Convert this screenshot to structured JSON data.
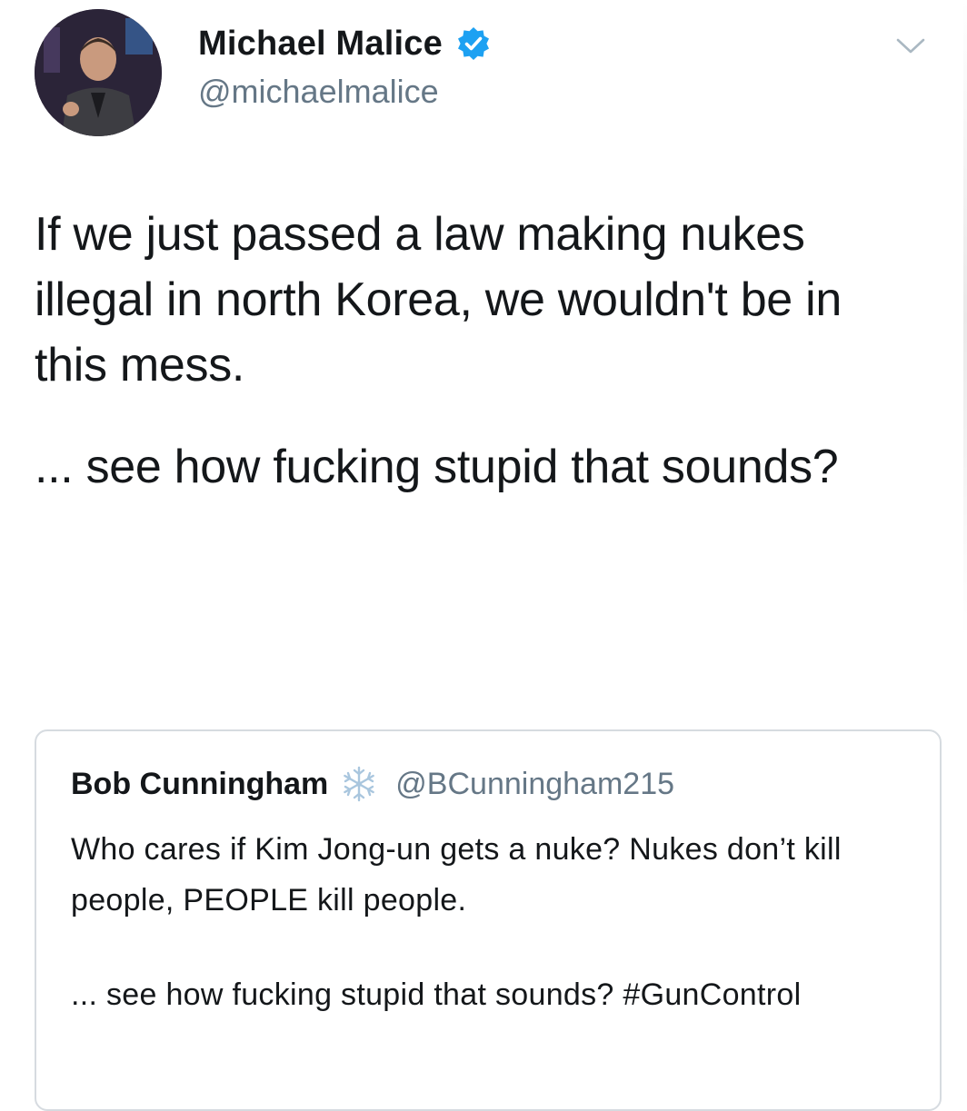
{
  "author": {
    "display_name": "Michael Malice",
    "handle": "@michaelmalice",
    "verified": true,
    "avatar_icon": "user-photo-avatar"
  },
  "tweet": {
    "paragraphs": [
      "If we just passed a law making nukes illegal in north Korea, we wouldn't be in this mess.",
      "... see how fucking stupid that sounds?"
    ]
  },
  "quoted_tweet": {
    "display_name": "Bob Cunningham",
    "badge_icon": "snowflake-icon",
    "handle": "@BCunningham215",
    "paragraphs": [
      "Who cares if Kim Jong-un gets a nuke? Nukes don’t kill people, PEOPLE kill people.",
      "... see how fucking stupid that sounds? #GunControl"
    ]
  },
  "colors": {
    "verified_blue": "#1da1f2",
    "text_primary": "#14171a",
    "text_secondary": "#657786",
    "border": "#d6dbe0",
    "snowflake": "#a9c6de"
  }
}
